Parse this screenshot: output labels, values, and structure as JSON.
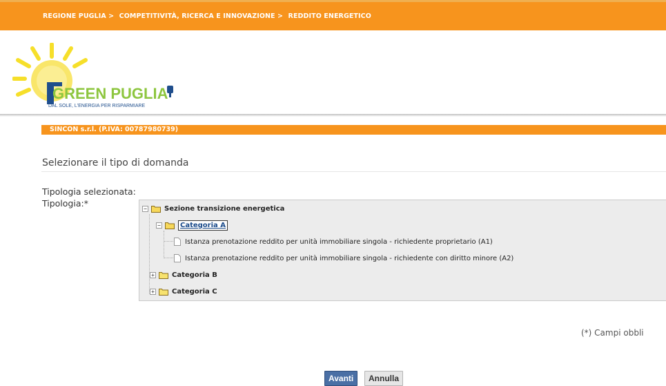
{
  "breadcrumb": [
    "REGIONE PUGLIA >",
    "COMPETITIVITÀ, RICERCA E INNOVAZIONE >",
    "REDDITO ENERGETICO"
  ],
  "logo": {
    "name": "GREEN PUGLIA",
    "tagline": "DAL SOLE, L'ENERGIA PER RISPARMIARE"
  },
  "company": "SINCON s.r.l. (P.IVA: 00787980739)",
  "section_title": "Selezionare il tipo di domanda",
  "labels": {
    "selected_type": "Tipologia selezionata:",
    "type": "Tipologia:*"
  },
  "tree": {
    "root": "Sezione transizione energetica",
    "cat_a": "Categoria A",
    "a1": "Istanza prenotazione reddito per unità immobiliare singola - richiedente proprietario (A1)",
    "a2": "Istanza prenotazione reddito per unità immobiliare singola - richiedente con diritto minore (A2)",
    "cat_b": "Categoria B",
    "cat_c": "Categoria C"
  },
  "required_note": "(*) Campi obbli",
  "buttons": {
    "next": "Avanti",
    "cancel": "Annulla"
  },
  "colors": {
    "orange": "#f7941d",
    "blue_button": "#4a6fa5",
    "logo_green": "#8dc63f",
    "logo_blue": "#1f4e8c"
  },
  "icons": [
    "folder-icon",
    "document-icon",
    "expand-icon",
    "collapse-icon",
    "sun-icon",
    "plug-icon"
  ]
}
